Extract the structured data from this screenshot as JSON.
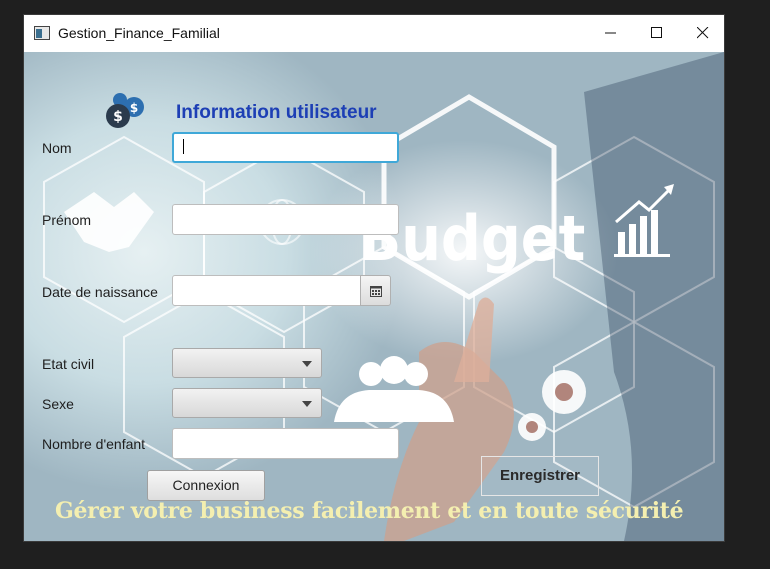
{
  "window": {
    "title": "Gestion_Finance_Familial"
  },
  "titlebar_icons": [
    "app-icon",
    "minimize-icon",
    "maximize-icon",
    "close-icon"
  ],
  "form": {
    "heading": "Information utilisateur",
    "labels": {
      "nom": "Nom",
      "prenom": "Prénom",
      "date_naissance": "Date de naissance",
      "etat_civil": "Etat civil",
      "sexe": "Sexe",
      "nombre_enfant": "Nombre d'enfant"
    },
    "values": {
      "nom": "",
      "prenom": "",
      "date_naissance": "",
      "etat_civil": "",
      "sexe": "",
      "nombre_enfant": ""
    }
  },
  "buttons": {
    "connexion": "Connexion",
    "enregistrer": "Enregistrer"
  },
  "background": {
    "budget_text": "Budget",
    "slogan": "Gérer votre business facilement et en toute sécurité"
  },
  "colors": {
    "heading": "#1d3fb5",
    "slogan": "#f4efb0",
    "focus_border": "#3fa8d8"
  }
}
